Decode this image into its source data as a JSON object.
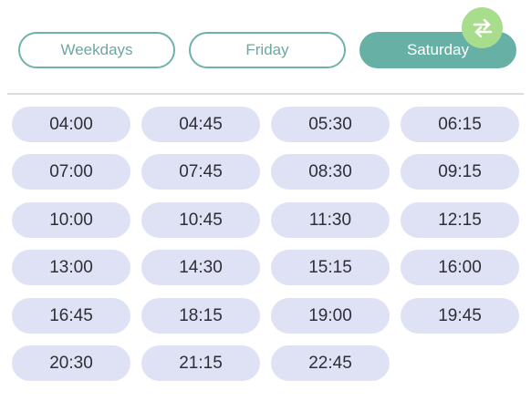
{
  "tabs": [
    {
      "label": "Weekdays",
      "active": false
    },
    {
      "label": "Friday",
      "active": false
    },
    {
      "label": "Saturday",
      "active": true
    }
  ],
  "swap_button": {
    "icon": "swap-arrows-icon",
    "color": "#a9dd8e"
  },
  "colors": {
    "accent": "#67b0a6",
    "slot_bg": "#dfe2f5",
    "text": "#2e2e36"
  },
  "times": [
    "04:00",
    "04:45",
    "05:30",
    "06:15",
    "07:00",
    "07:45",
    "08:30",
    "09:15",
    "10:00",
    "10:45",
    "11:30",
    "12:15",
    "13:00",
    "14:30",
    "15:15",
    "16:00",
    "16:45",
    "18:15",
    "19:00",
    "19:45",
    "20:30",
    "21:15",
    "22:45"
  ]
}
